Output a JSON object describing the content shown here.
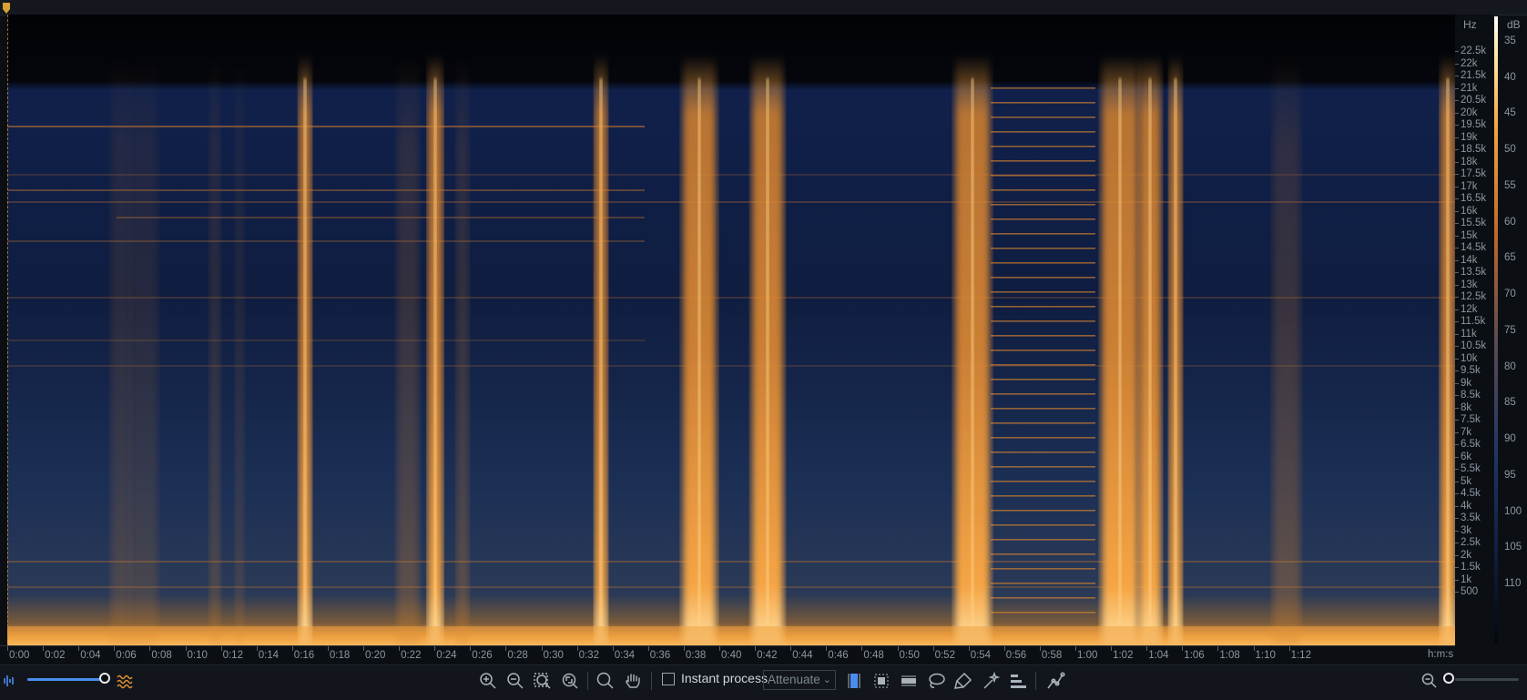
{
  "spectrogram": {
    "freq_unit": "Hz",
    "freq_labels": [
      "22.5k",
      "22k",
      "21.5k",
      "21k",
      "20.5k",
      "20k",
      "19.5k",
      "19k",
      "18.5k",
      "18k",
      "17.5k",
      "17k",
      "16.5k",
      "16k",
      "15.5k",
      "15k",
      "14.5k",
      "14k",
      "13.5k",
      "13k",
      "12.5k",
      "12k",
      "11.5k",
      "11k",
      "10.5k",
      "10k",
      "9.5k",
      "9k",
      "8.5k",
      "8k",
      "7.5k",
      "7k",
      "6.5k",
      "6k",
      "5.5k",
      "5k",
      "4.5k",
      "4k",
      "3.5k",
      "3k",
      "2.5k",
      "2k",
      "1.5k",
      "1k",
      "500"
    ],
    "db_unit": "dB",
    "db_labels": [
      "35",
      "40",
      "45",
      "50",
      "55",
      "60",
      "65",
      "70",
      "75",
      "80",
      "85",
      "90",
      "95",
      "100",
      "105",
      "110"
    ],
    "time_labels": [
      "0:00",
      "0:02",
      "0:04",
      "0:06",
      "0:08",
      "0:10",
      "0:12",
      "0:14",
      "0:16",
      "0:18",
      "0:20",
      "0:22",
      "0:24",
      "0:26",
      "0:28",
      "0:30",
      "0:32",
      "0:34",
      "0:36",
      "0:38",
      "0:40",
      "0:42",
      "0:44",
      "0:46",
      "0:48",
      "0:50",
      "0:52",
      "0:54",
      "0:56",
      "0:58",
      "1:00",
      "1:02",
      "1:04",
      "1:06",
      "1:08",
      "1:10",
      "1:12"
    ],
    "time_unit": "h:m:s",
    "colors": {
      "background": "#0b0f14",
      "spectrum_low": "#0f1c3e",
      "spectrum_high": "#f6a640",
      "accent": "#4a8df0"
    }
  },
  "toolbar": {
    "waveform_icon": "waveform-icon",
    "spectrogram_icon": "spectrogram-icon",
    "icons": [
      "zoom-in-icon",
      "zoom-out-icon",
      "zoom-selection-icon",
      "zoom-fit-icon",
      "magnify-icon",
      "hand-icon"
    ],
    "instant_process_label": "Instant process",
    "instant_process_checked": false,
    "mode_value": "Attenuate",
    "tool_icons": [
      "time-select-icon",
      "time-frequency-select-icon",
      "frequency-select-icon",
      "lasso-icon",
      "brush-icon",
      "magic-wand-icon",
      "harmonic-select-icon",
      "curve-tool-icon"
    ]
  }
}
